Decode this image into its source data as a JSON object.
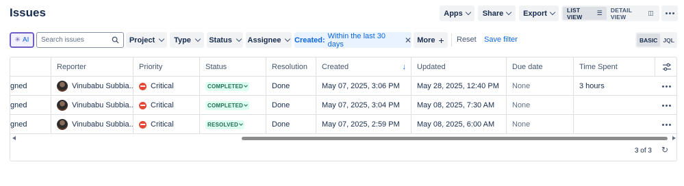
{
  "page": {
    "title": "Issues"
  },
  "toolbar": {
    "apps": "Apps",
    "share": "Share",
    "export": "Export",
    "list_view": "LIST VIEW",
    "detail_view": "DETAIL VIEW"
  },
  "filters": {
    "ai": "AI",
    "search_placeholder": "Search issues",
    "project": "Project",
    "type": "Type",
    "status": "Status",
    "assignee": "Assignee",
    "created_key": "Created:",
    "created_value": "Within the last 30 days",
    "more": "More",
    "reset": "Reset",
    "save_filter": "Save filter",
    "basic": "BASIC",
    "jql": "JQL"
  },
  "table": {
    "columns": [
      "",
      "Reporter",
      "Priority",
      "Status",
      "Resolution",
      "Created",
      "Updated",
      "Due date",
      "Time Spent"
    ],
    "rows": [
      {
        "assignee": "gned",
        "reporter": "Vinubabu Subbia...",
        "priority": "Critical",
        "status": "COMPLETED",
        "resolution": "Done",
        "created": "May 07, 2025, 3:06 PM",
        "updated": "May 28, 2025, 12:40 PM",
        "due": "None",
        "time_spent": "3 hours"
      },
      {
        "assignee": "gned",
        "reporter": "Vinubabu Subbia...",
        "priority": "Critical",
        "status": "COMPLETED",
        "resolution": "Done",
        "created": "May 07, 2025, 3:04 PM",
        "updated": "May 08, 2025, 7:30 AM",
        "due": "None",
        "time_spent": ""
      },
      {
        "assignee": "gned",
        "reporter": "Vinubabu Subbia...",
        "priority": "Critical",
        "status": "RESOLVED",
        "resolution": "Done",
        "created": "May 07, 2025, 2:59 PM",
        "updated": "May 08, 2025, 6:00 AM",
        "due": "None",
        "time_spent": ""
      }
    ],
    "pager": "3 of 3"
  },
  "colors": {
    "accent": "#0c66e4",
    "critical": "#e34935",
    "done_green": "#216e4e",
    "ai_border": "#6e5dc6"
  }
}
